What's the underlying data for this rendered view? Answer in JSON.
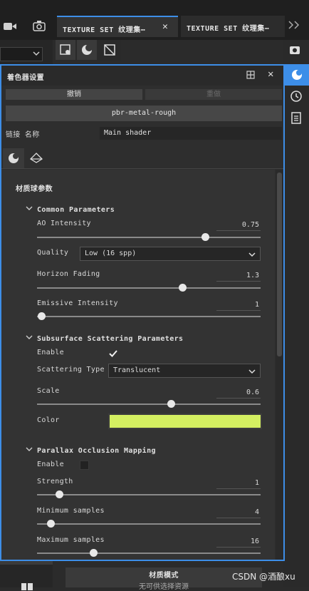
{
  "top_tabs": [
    "TEXTURE SET 纹理集⋯",
    "TEXTURE SET 纹理集⋯"
  ],
  "shader_panel": {
    "title": "着色器设置",
    "undo_label": "撤销",
    "redo_label": "重做",
    "shader_name": "pbr-metal-rough",
    "link_label": "链接 名称",
    "link_value": "Main shader",
    "params_title": "材质球参数"
  },
  "common": {
    "title": "Common Parameters",
    "ao_label": "AO Intensity",
    "ao_value": "0.75",
    "ao_level": 0.75,
    "quality_label": "Quality",
    "quality_value": "Low (16 spp)",
    "horizon_label": "Horizon Fading",
    "horizon_value": "1.3",
    "horizon_level": 0.65,
    "emissive_label": "Emissive Intensity",
    "emissive_value": "1",
    "emissive_level": 0.02
  },
  "sss": {
    "title": "Subsurface Scattering Parameters",
    "enable_label": "Enable",
    "enable_checked": true,
    "type_label": "Scattering Type",
    "type_value": "Translucent",
    "scale_label": "Scale",
    "scale_value": "0.6",
    "scale_level": 0.6,
    "color_label": "Color",
    "color_hex": "#d4ef61"
  },
  "pom": {
    "title": "Parallax Occlusion Mapping",
    "enable_label": "Enable",
    "enable_checked": false,
    "strength_label": "Strength",
    "strength_value": "1",
    "strength_level": 0.1,
    "min_label": "Minimum samples",
    "min_value": "4",
    "min_level": 0.06,
    "max_label": "Maximum samples",
    "max_value": "16",
    "max_level": 0.25
  },
  "bottom": {
    "mode_label": "材质模式",
    "hint": "无可供选择资源",
    "watermark": "CSDN @酒酿xu"
  },
  "colors": {
    "accent": "#3d8ee8",
    "panel_bg": "#2e2e2e"
  }
}
